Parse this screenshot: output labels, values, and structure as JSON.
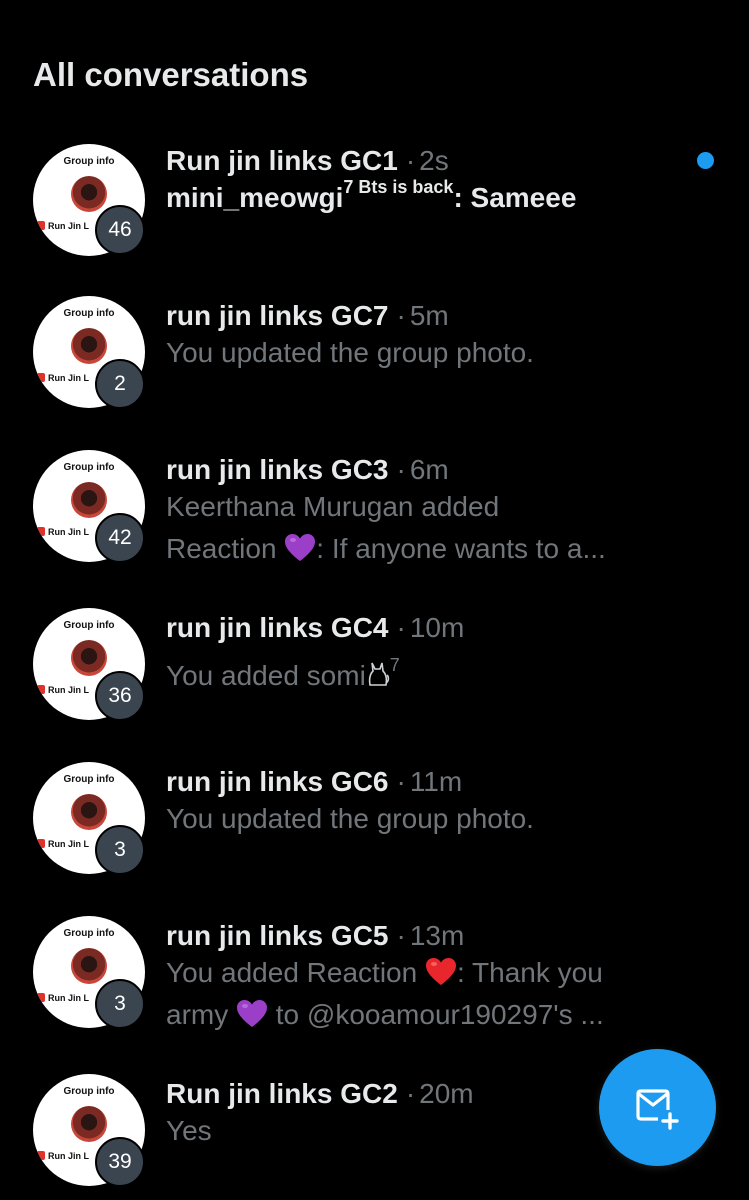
{
  "header": {
    "title": "All conversations"
  },
  "conversations": [
    {
      "name": "Run jin links GC1",
      "time": "2s",
      "unread": true,
      "badge": "46",
      "avatar": {
        "group_info": "Group info",
        "label": "Run Jin L"
      },
      "sender": "mini_meowgi",
      "sender_sup": "7 Bts is back",
      "message": ": Sameee"
    },
    {
      "name": "run jin links GC7",
      "time": "5m",
      "badge": "2",
      "avatar": {
        "group_info": "Group info",
        "label": "Run Jin L"
      },
      "message": "You updated the group photo."
    },
    {
      "name": "run jin links GC3",
      "time": "6m",
      "badge": "42",
      "avatar": {
        "group_info": "Group info",
        "label": "Run Jin L"
      },
      "message_line1": "Keerthana Murugan added",
      "message_line2_pre": "Reaction ",
      "message_line2_post": ": If anyone wants to a..."
    },
    {
      "name": "run jin links GC4",
      "time": "10m",
      "badge": "36",
      "avatar": {
        "group_info": "Group info",
        "label": "Run Jin L"
      },
      "message": "You added somi",
      "message_sup": "7"
    },
    {
      "name": "run jin links GC6",
      "time": "11m",
      "badge": "3",
      "avatar": {
        "group_info": "Group info",
        "label": "Run Jin L"
      },
      "message": "You updated the group photo."
    },
    {
      "name": "run jin links GC5",
      "time": "13m",
      "badge": "3",
      "avatar": {
        "group_info": "Group info",
        "label": "Run Jin L"
      },
      "message_line1_pre": "You added Reaction ",
      "message_line1_post": ": Thank you",
      "message_line2_pre": "army ",
      "message_line2_post": " to @kooamour190297's ..."
    },
    {
      "name": "Run jin links GC2",
      "time": "20m",
      "badge": "39",
      "avatar": {
        "group_info": "Group info",
        "label": "Run Jin L"
      },
      "message": "Yes"
    }
  ],
  "separator": "·",
  "colors": {
    "background": "#000000",
    "primary_text": "#e7e9ea",
    "secondary_text": "#71767b",
    "accent": "#1d9bf0",
    "badge_bg": "#3b4550"
  },
  "icons": {
    "fab": "new-message-icon",
    "purple_heart": "purple-heart-emoji",
    "red_heart": "red-heart-emoji",
    "cat": "cat-emoji"
  }
}
